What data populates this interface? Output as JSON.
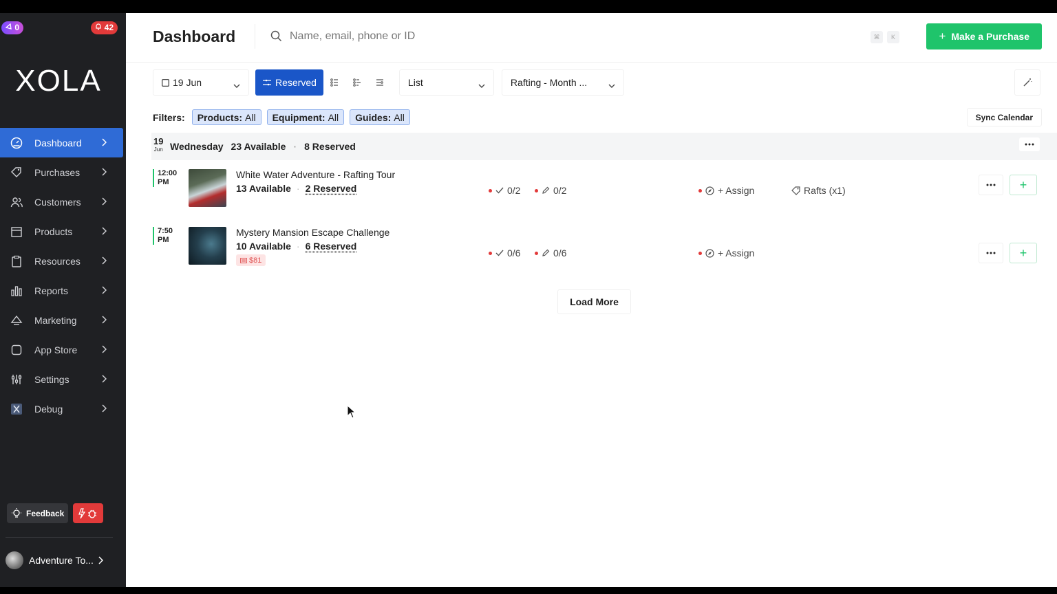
{
  "sidebar": {
    "badge_left": "0",
    "badge_right": "42",
    "logo": "XOLA",
    "items": [
      {
        "label": "Dashboard",
        "icon": "dashboard-icon"
      },
      {
        "label": "Purchases",
        "icon": "tag-icon"
      },
      {
        "label": "Customers",
        "icon": "users-icon"
      },
      {
        "label": "Products",
        "icon": "box-icon"
      },
      {
        "label": "Resources",
        "icon": "clipboard-icon"
      },
      {
        "label": "Reports",
        "icon": "bar-chart-icon"
      },
      {
        "label": "Marketing",
        "icon": "megaphone-icon"
      },
      {
        "label": "App Store",
        "icon": "square-icon"
      },
      {
        "label": "Settings",
        "icon": "sliders-icon"
      },
      {
        "label": "Debug",
        "icon": "x-box-icon"
      }
    ],
    "feedback_label": "Feedback",
    "account_name": "Adventure To..."
  },
  "header": {
    "title": "Dashboard",
    "search_placeholder": "Name, email, phone or ID",
    "kbd_1": "⌘",
    "kbd_2": "K",
    "purchase_label": "Make a Purchase"
  },
  "toolbar": {
    "date": "19 Jun",
    "reserved_label": "Reserved",
    "view": "List",
    "activity": "Rafting - Month ...",
    "sync_label": "Sync Calendar"
  },
  "filters": {
    "label": "Filters:",
    "chips": [
      {
        "name": "Products:",
        "value": "All"
      },
      {
        "name": "Equipment:",
        "value": "All"
      },
      {
        "name": "Guides:",
        "value": "All"
      }
    ]
  },
  "day": {
    "num": "19",
    "month": "Jun",
    "weekday": "Wednesday",
    "available": "23 Available",
    "reserved": "8 Reserved"
  },
  "events": [
    {
      "time_1": "12:00",
      "time_2": "PM",
      "title": "White Water Adventure - Rafting Tour",
      "available": "13 Available",
      "reserved": "2 Reserved",
      "checkin": "0/2",
      "waiver": "0/2",
      "assign": "+ Assign",
      "equipment": "Rafts (x1)"
    },
    {
      "time_1": "7:50",
      "time_2": "PM",
      "title": "Mystery Mansion Escape Challenge",
      "available": "10 Available",
      "reserved": "6 Reserved",
      "price": "$81",
      "checkin": "0/6",
      "waiver": "0/6",
      "assign": "+ Assign"
    }
  ],
  "load_more": "Load More",
  "colors": {
    "sidebar_bg": "#1f2023",
    "active_nav": "#2f6bd6",
    "primary_green": "#1fc46b",
    "segment_blue": "#1a56c8",
    "alert_red": "#e23a3a"
  }
}
